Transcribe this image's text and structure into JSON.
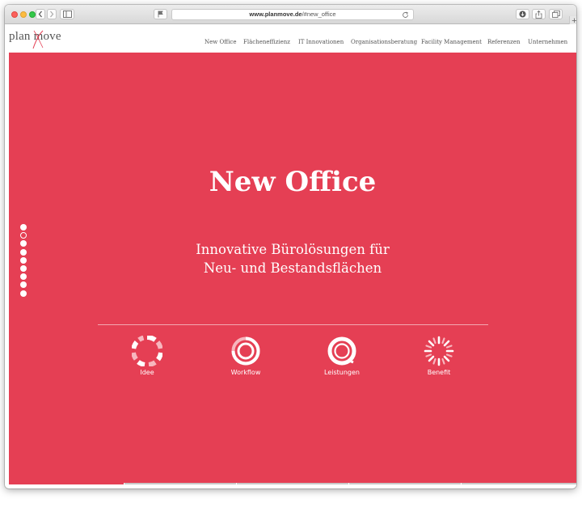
{
  "browser": {
    "url_host": "www.planmove.de",
    "url_path": "/#new_office",
    "plus_label": "+"
  },
  "site": {
    "logo_text": "plan move",
    "nav": [
      {
        "label": "New Office"
      },
      {
        "label": "Flächeneffizienz"
      },
      {
        "label": "IT Innovationen"
      },
      {
        "label": "Organisationsberatung"
      },
      {
        "label": "Facility Management"
      },
      {
        "label": "Referenzen"
      },
      {
        "label": "Unternehmen"
      }
    ]
  },
  "hero": {
    "title": "New Office",
    "subtitle_line1": "Innovative Bürolösungen für",
    "subtitle_line2": "Neu- und Bestandsflächen",
    "background_color": "#e53f54",
    "features": [
      {
        "label": "Idee",
        "icon": "idea-ring-icon"
      },
      {
        "label": "Workflow",
        "icon": "workflow-ring-icon"
      },
      {
        "label": "Leistungen",
        "icon": "services-ring-icon"
      },
      {
        "label": "Benefit",
        "icon": "benefit-burst-icon"
      }
    ],
    "section_dots_count": 9,
    "active_section_dot": 2
  }
}
